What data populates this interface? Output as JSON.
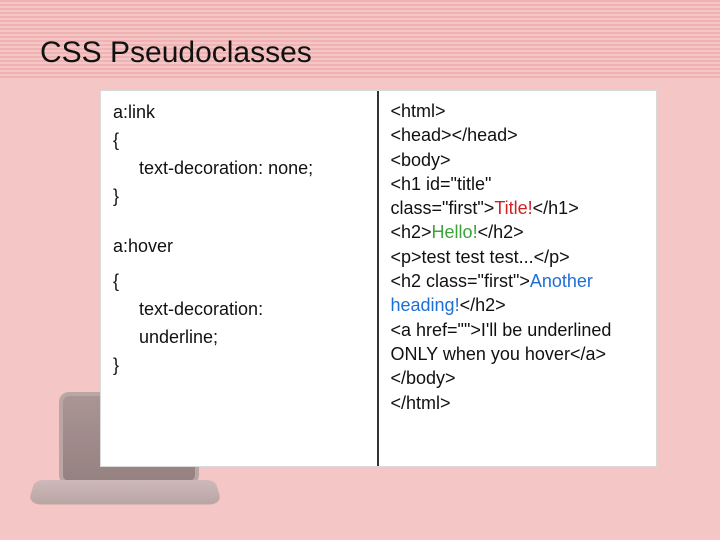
{
  "title": "CSS Pseudoclasses",
  "css_panel": {
    "rule1_selector": "a:link",
    "brace_open": "{",
    "rule1_decl": "text-decoration:  none;",
    "brace_close": "}",
    "rule2_selector": "a:hover",
    "rule2_decl_line1": "text-decoration:",
    "rule2_decl_line2": "underline;"
  },
  "html_panel": {
    "l1": "<html>",
    "l2": "<head></head>",
    "l3": "<body>",
    "l4a": "<h1 id=\"title\"",
    "l4b_pre": "class=\"first\">",
    "l4b_red": "Title!",
    "l4b_post": "</h1>",
    "l5_pre": "<h2>",
    "l5_green": "Hello!",
    "l5_post": "</h2>",
    "l6": "<p>test test test...</p>",
    "l7_pre": "<h2 class=\"first\">",
    "l7_blue1": "Another",
    "l7_blue2": "heading!",
    "l7_post": "</h2>",
    "l8a": "<a href=\"\">I'll be underlined",
    "l8b": "ONLY when you hover</a>",
    "l9": "</body>",
    "l10": "</html>"
  }
}
